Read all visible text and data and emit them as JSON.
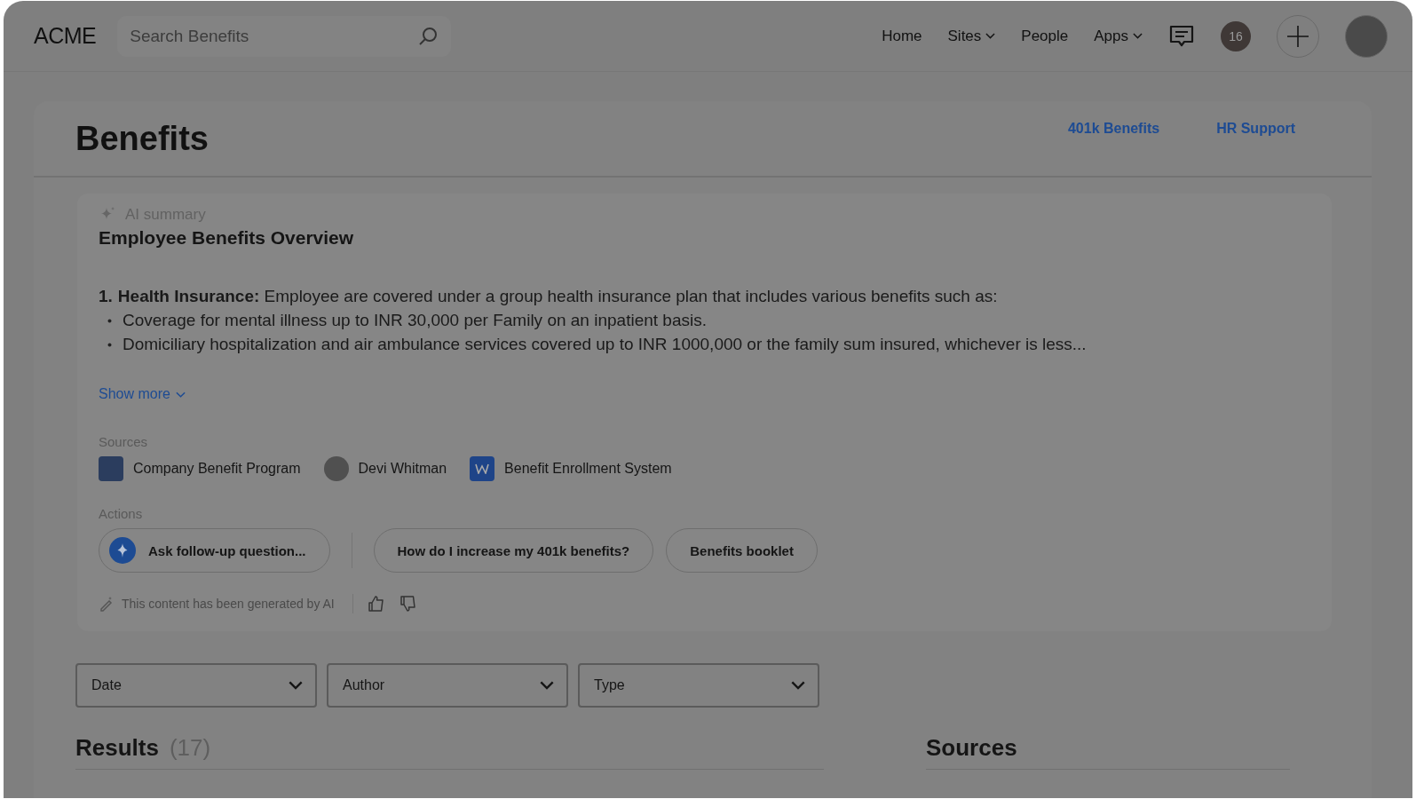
{
  "header": {
    "logo": "ACME",
    "search": {
      "placeholder": "Search Benefits"
    },
    "nav": [
      {
        "label": "Home",
        "has_menu": false
      },
      {
        "label": "Sites",
        "has_menu": true
      },
      {
        "label": "People",
        "has_menu": false
      },
      {
        "label": "Apps",
        "has_menu": true
      }
    ],
    "notification_count": "16"
  },
  "page": {
    "title": "Benefits",
    "links": [
      "401k Benefits",
      "HR Support"
    ]
  },
  "summary": {
    "label": "AI summary",
    "title": "Employee Benefits Overview",
    "points": [
      {
        "number": "1.",
        "lead": "Health Insurance:",
        "text": "Employee are covered under a group health insurance plan that includes various benefits such as:"
      }
    ],
    "bullets": [
      "Coverage for mental illness up to INR 30,000 per Family on an inpatient basis.",
      "Domiciliary hospitalization and air ambulance services covered up to INR 1000,000 or the family sum insured, whichever is less..."
    ],
    "show_more": "Show more",
    "sources_label": "Sources",
    "sources": [
      {
        "kind": "page",
        "label": "Company Benefit Program"
      },
      {
        "kind": "person",
        "label": "Devi Whitman"
      },
      {
        "kind": "document",
        "label": "Benefit Enrollment System"
      }
    ],
    "actions_label": "Actions",
    "actions": [
      {
        "kind": "ask",
        "label": "Ask follow-up question..."
      },
      {
        "kind": "suggestion",
        "label": "How do I increase my 401k benefits?"
      },
      {
        "kind": "suggestion",
        "label": "Benefits booklet"
      }
    ],
    "disclaimer": "This content has been generated by AI"
  },
  "filters": [
    {
      "label": "Date"
    },
    {
      "label": "Author"
    },
    {
      "label": "Type"
    }
  ],
  "results": {
    "title": "Results",
    "count": "(17)"
  },
  "sources_heading": "Sources"
}
